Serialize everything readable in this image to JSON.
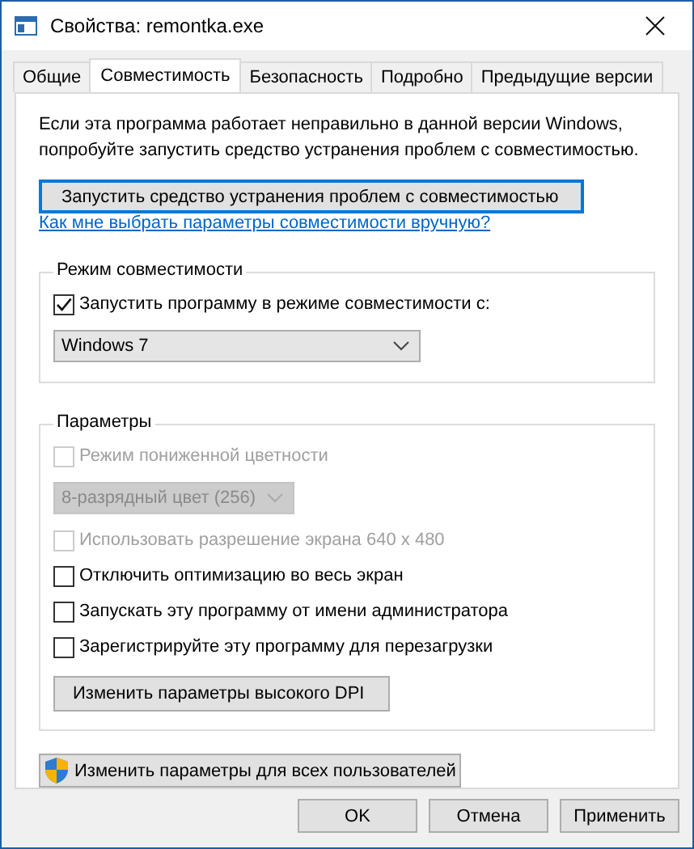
{
  "window": {
    "title": "Свойства: remontka.exe"
  },
  "tabs": [
    {
      "label": "Общие",
      "selected": false
    },
    {
      "label": "Совместимость",
      "selected": true
    },
    {
      "label": "Безопасность",
      "selected": false
    },
    {
      "label": "Подробно",
      "selected": false
    },
    {
      "label": "Предыдущие версии",
      "selected": false
    }
  ],
  "intro": "Если эта программа работает неправильно в данной версии Windows, попробуйте запустить средство устранения проблем с совместимостью.",
  "troubleshoot_button": {
    "label": "Запустить средство устранения проблем с совместимостью",
    "focused": true
  },
  "help_link": "Как мне выбрать параметры совместимости вручную?",
  "compat_group": {
    "title": "Режим совместимости",
    "items": [
      {
        "kind": "checkbox",
        "label": "Запустить программу в режиме совместимости с:",
        "checked": true,
        "disabled": false
      },
      {
        "kind": "dropdown",
        "value": "Windows 7",
        "disabled": false,
        "wide": true
      }
    ]
  },
  "settings_group": {
    "title": "Параметры",
    "items": [
      {
        "kind": "checkbox",
        "label": "Режим пониженной цветности",
        "checked": false,
        "disabled": true
      },
      {
        "kind": "dropdown",
        "value": "8-разрядный цвет (256)",
        "disabled": true,
        "wide": false
      },
      {
        "kind": "checkbox",
        "label": "Использовать разрешение экрана 640 x 480",
        "checked": false,
        "disabled": true
      },
      {
        "kind": "checkbox",
        "label": "Отключить оптимизацию во весь экран",
        "checked": false,
        "disabled": false
      },
      {
        "kind": "checkbox",
        "label": "Запускать эту программу от имени администратора",
        "checked": false,
        "disabled": false
      },
      {
        "kind": "checkbox",
        "label": "Зарегистрируйте эту программу для перезагрузки",
        "checked": false,
        "disabled": false
      },
      {
        "kind": "button",
        "label": "Изменить параметры высокого DPI"
      }
    ]
  },
  "all_users_button": {
    "label": "Изменить параметры для всех пользователей"
  },
  "buttons": [
    "OK",
    "Отмена",
    "Применить"
  ]
}
